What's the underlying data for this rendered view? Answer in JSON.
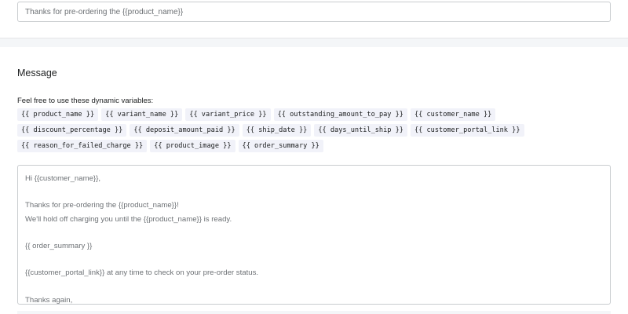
{
  "subject": {
    "value": "Thanks for pre-ordering the {{product_name}}"
  },
  "message_section": {
    "title": "Message",
    "variables_label": "Feel free to use these dynamic variables:",
    "variable_rows": [
      [
        "{{ product_name }}",
        "{{ variant_name }}",
        "{{ variant_price }}",
        "{{ outstanding_amount_to_pay }}",
        "{{ customer_name }}"
      ],
      [
        "{{ discount_percentage }}",
        "{{ deposit_amount_paid }}",
        "{{ ship_date }}",
        "{{ days_until_ship }}",
        "{{ customer_portal_link }}"
      ],
      [
        "{{ reason_for_failed_charge }}",
        "{{ product_image }}",
        "{{ order_summary }}"
      ]
    ],
    "message_lines": [
      "Hi {{customer_name}},",
      "",
      "Thanks for pre-ordering the {{product_name}}!",
      "We'll hold off charging you until the {{product_name}} is ready.",
      "",
      "{{ order_summary }}",
      "",
      "{{customer_portal_link}} at any time to check on your pre-order status.",
      "",
      "Thanks again,"
    ]
  }
}
